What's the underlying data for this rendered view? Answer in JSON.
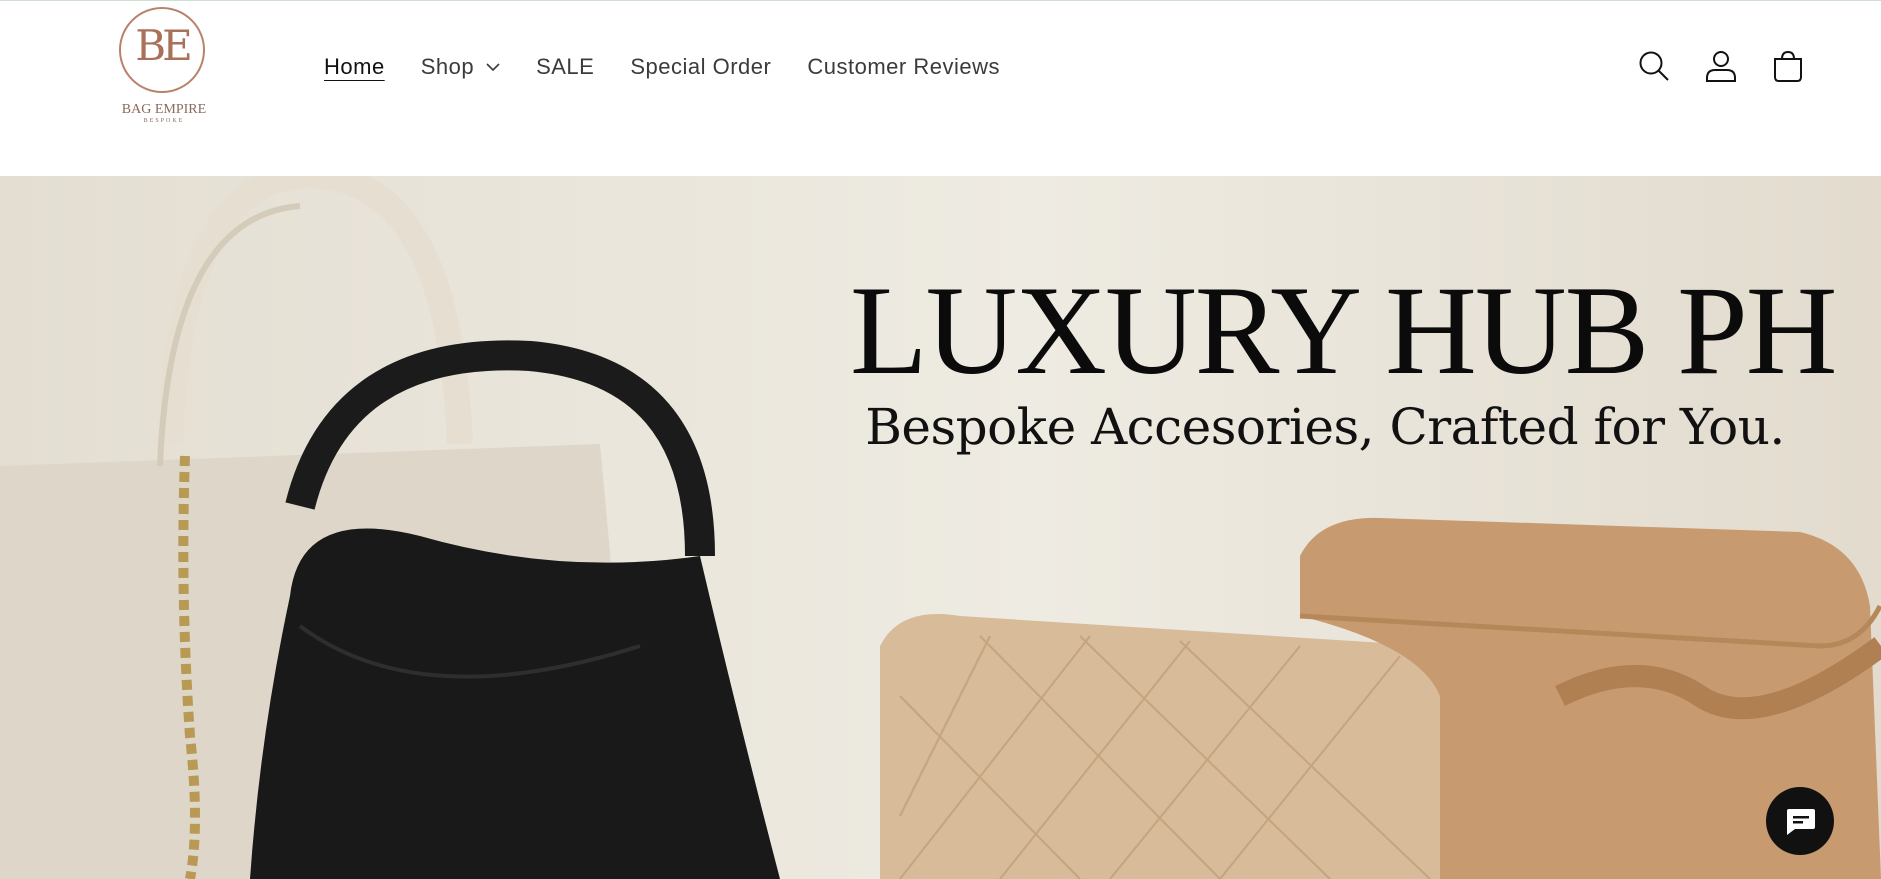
{
  "brand": {
    "logo_mark": "BE",
    "logo_name": "BAG EMPIRE",
    "logo_tagline": "BESPOKE"
  },
  "nav": {
    "items": [
      {
        "label": "Home",
        "active": true
      },
      {
        "label": "Shop",
        "has_dropdown": true
      },
      {
        "label": "SALE"
      },
      {
        "label": "Special Order"
      },
      {
        "label": "Customer Reviews"
      }
    ]
  },
  "header_icons": [
    "search-icon",
    "account-icon",
    "cart-icon"
  ],
  "hero": {
    "title": "LUXURY HUB PH",
    "subtitle": "Bespoke Accesories, Crafted for You."
  },
  "chat_widget": {
    "icon": "chat-icon"
  },
  "colors": {
    "brand_accent": "#a9705a",
    "text": "#121212",
    "hero_bg": "#ece8de",
    "chat_button": "#111111"
  }
}
